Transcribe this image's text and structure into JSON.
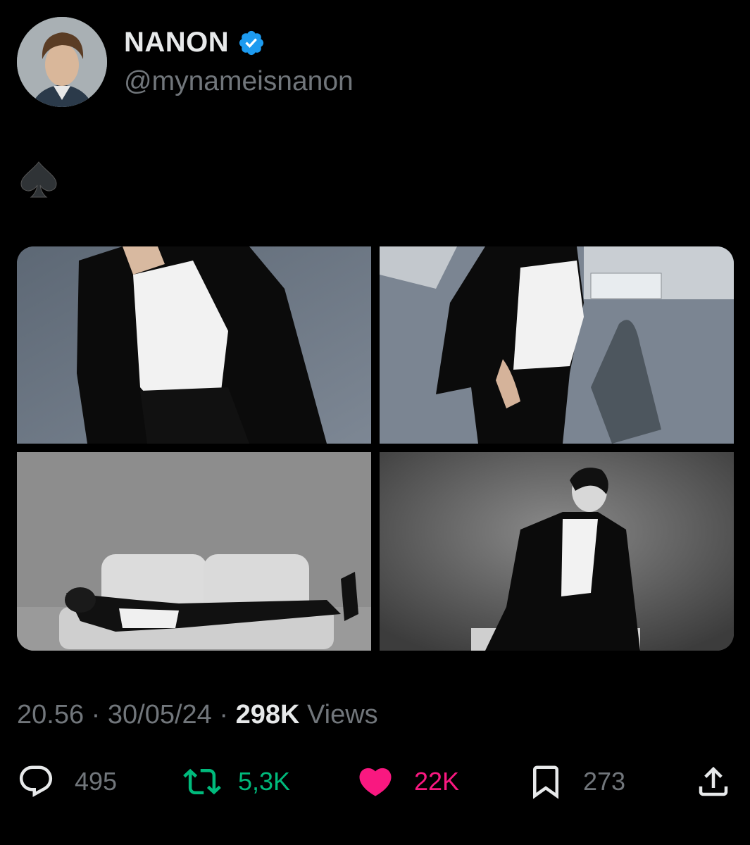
{
  "author": {
    "display_name": "NANON",
    "handle": "@mynameisnanon",
    "verified": true,
    "verified_color": "#1d9bf0"
  },
  "tweet": {
    "text": "♠️"
  },
  "media": {
    "count": 4,
    "items": [
      {
        "icon": "photo"
      },
      {
        "icon": "photo"
      },
      {
        "icon": "photo"
      },
      {
        "icon": "photo"
      }
    ]
  },
  "meta": {
    "time": "20.56",
    "separator": "·",
    "date": "30/05/24",
    "views_count": "298K",
    "views_label": "Views"
  },
  "actions": {
    "reply": {
      "icon": "reply-icon",
      "count": "495"
    },
    "retweet": {
      "icon": "retweet-icon",
      "count": "5,3K",
      "color": "#00ba7c"
    },
    "like": {
      "icon": "heart-icon",
      "count": "22K",
      "color": "#f91880"
    },
    "bookmark": {
      "icon": "bookmark-icon",
      "count": "273"
    },
    "share": {
      "icon": "share-icon"
    }
  }
}
